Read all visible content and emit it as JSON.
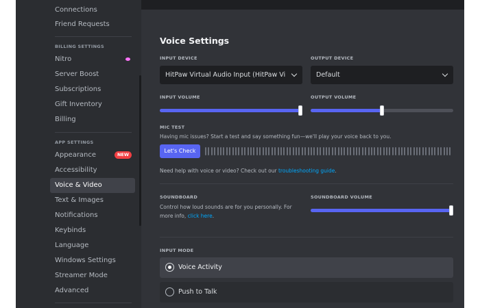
{
  "sidebar": {
    "items_top": [
      {
        "label": "Connections"
      },
      {
        "label": "Friend Requests"
      }
    ],
    "billing_header": "BILLING SETTINGS",
    "billing_items": [
      {
        "label": "Nitro"
      },
      {
        "label": "Server Boost"
      },
      {
        "label": "Subscriptions"
      },
      {
        "label": "Gift Inventory"
      },
      {
        "label": "Billing"
      }
    ],
    "app_header": "APP SETTINGS",
    "app_items": [
      {
        "label": "Appearance",
        "badge": "NEW"
      },
      {
        "label": "Accessibility"
      },
      {
        "label": "Voice & Video"
      },
      {
        "label": "Text & Images"
      },
      {
        "label": "Notifications"
      },
      {
        "label": "Keybinds"
      },
      {
        "label": "Language"
      },
      {
        "label": "Windows Settings"
      },
      {
        "label": "Streamer Mode"
      },
      {
        "label": "Advanced"
      }
    ],
    "active_item": "Voice & Video"
  },
  "main": {
    "title": "Voice Settings",
    "input_device": {
      "label": "INPUT DEVICE",
      "value": "HitPaw Virtual Audio Input (HitPaw Virtual Audio)"
    },
    "output_device": {
      "label": "OUTPUT DEVICE",
      "value": "Default"
    },
    "input_volume": {
      "label": "INPUT VOLUME",
      "level_percent": 100
    },
    "output_volume": {
      "label": "OUTPUT VOLUME",
      "level_percent": 50
    },
    "mic_test": {
      "label": "MIC TEST",
      "description": "Having mic issues? Start a test and say something fun—we'll play your voice back to you.",
      "button": "Let's Check"
    },
    "help": {
      "text": "Need help with voice or video? Check out our ",
      "link": "troubleshooting guide",
      "suffix": "."
    },
    "soundboard": {
      "label": "SOUNDBOARD",
      "description_line1": "Control how loud sounds are for you personally. For",
      "description_line2": "more info, ",
      "link": "click here",
      "suffix": "."
    },
    "soundboard_volume": {
      "label": "SOUNDBOARD VOLUME",
      "level_percent": 100
    },
    "input_mode": {
      "label": "INPUT MODE",
      "options": [
        {
          "label": "Voice Activity",
          "selected": true
        },
        {
          "label": "Push to Talk",
          "selected": false
        }
      ]
    }
  },
  "colors": {
    "accent": "#5865f2",
    "link": "#00a8fc",
    "new_badge": "#f23f43",
    "nitro": "#ff73fa",
    "sidebar_bg": "#2b2d31",
    "content_bg": "#313338"
  }
}
